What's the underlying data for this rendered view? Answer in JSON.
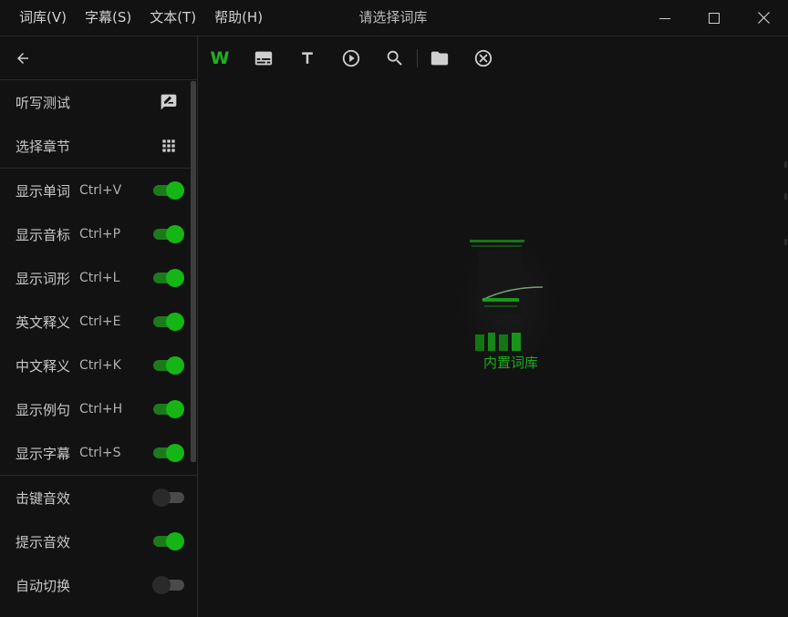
{
  "menu": [
    "词库(V)",
    "字幕(S)",
    "文本(T)",
    "帮助(H)"
  ],
  "window_title": "请选择词库",
  "sidebar": {
    "top_items": [
      {
        "label": "听写测试",
        "icon": "rate-review-icon"
      },
      {
        "label": "选择章节",
        "icon": "apps-grid-icon"
      }
    ],
    "toggles": [
      {
        "label": "显示单词",
        "shortcut": "Ctrl+V",
        "on": true
      },
      {
        "label": "显示音标",
        "shortcut": "Ctrl+P",
        "on": true
      },
      {
        "label": "显示词形",
        "shortcut": "Ctrl+L",
        "on": true
      },
      {
        "label": "英文释义",
        "shortcut": "Ctrl+E",
        "on": true
      },
      {
        "label": "中文释义",
        "shortcut": "Ctrl+K",
        "on": true
      },
      {
        "label": "显示例句",
        "shortcut": "Ctrl+H",
        "on": true
      },
      {
        "label": "显示字幕",
        "shortcut": "Ctrl+S",
        "on": true
      }
    ],
    "sound_toggles": [
      {
        "label": "击键音效",
        "on": false
      },
      {
        "label": "提示音效",
        "on": true
      },
      {
        "label": "自动切换",
        "on": false
      }
    ]
  },
  "toolbar": {
    "word_glyph": "W",
    "text_glyph": "T"
  },
  "main": {
    "library_label": "内置词库"
  },
  "colors": {
    "accent": "#15b515",
    "background": "#121212",
    "text": "#c8c8c8"
  }
}
